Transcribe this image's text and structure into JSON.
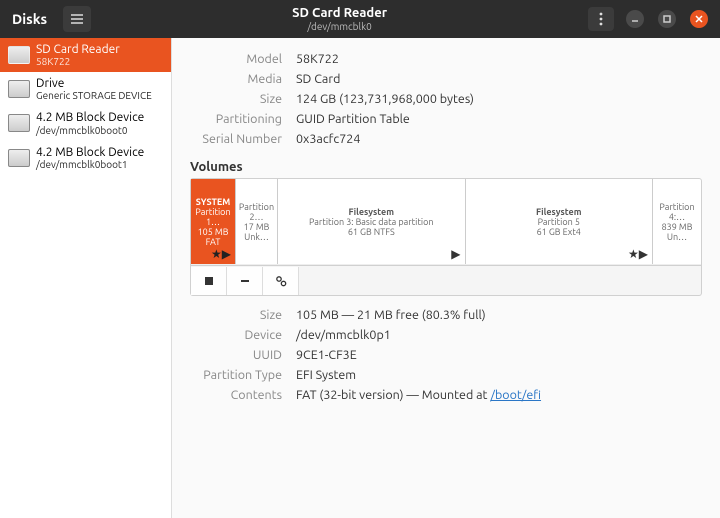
{
  "titlebar": {
    "app_name": "Disks",
    "window_title": "SD Card Reader",
    "window_subtitle": "/dev/mmcblk0"
  },
  "sidebar": {
    "items": [
      {
        "label": "SD Card Reader",
        "sub": "58K722",
        "selected": true
      },
      {
        "label": "Drive",
        "sub": "Generic STORAGE DEVICE",
        "selected": false
      },
      {
        "label": "4.2 MB Block Device",
        "sub": "/dev/mmcblk0boot0",
        "selected": false
      },
      {
        "label": "4.2 MB Block Device",
        "sub": "/dev/mmcblk0boot1",
        "selected": false
      }
    ]
  },
  "disk_info": {
    "model_label": "Model",
    "model": "58K722",
    "media_label": "Media",
    "media": "SD Card",
    "size_label": "Size",
    "size": "124 GB (123,731,968,000 bytes)",
    "partitioning_label": "Partitioning",
    "partitioning": "GUID Partition Table",
    "serial_label": "Serial Number",
    "serial": "0x3acfc724"
  },
  "volumes": {
    "heading": "Volumes",
    "partitions": [
      {
        "name": "SYSTEM",
        "line2": "Partition 1…",
        "line3": "105 MB FAT",
        "star": true,
        "play": true,
        "selected": true
      },
      {
        "name": "",
        "line2": "Partition 2…",
        "line3": "17 MB Unk…",
        "star": false,
        "play": false,
        "selected": false
      },
      {
        "name": "Filesystem",
        "line2": "Partition 3: Basic data partition",
        "line3": "61 GB NTFS",
        "star": false,
        "play": true,
        "selected": false
      },
      {
        "name": "Filesystem",
        "line2": "Partition 5",
        "line3": "61 GB Ext4",
        "star": true,
        "play": true,
        "selected": false
      },
      {
        "name": "",
        "line2": "Partition 4:…",
        "line3": "839 MB Un…",
        "star": false,
        "play": false,
        "selected": false
      }
    ]
  },
  "partition_detail": {
    "size_label": "Size",
    "size": "105 MB — 21 MB free (80.3% full)",
    "device_label": "Device",
    "device": "/dev/mmcblk0p1",
    "uuid_label": "UUID",
    "uuid": "9CE1-CF3E",
    "ptype_label": "Partition Type",
    "ptype": "EFI System",
    "contents_label": "Contents",
    "contents_prefix": "FAT (32-bit version) — Mounted at ",
    "mount_point": "/boot/efi"
  }
}
